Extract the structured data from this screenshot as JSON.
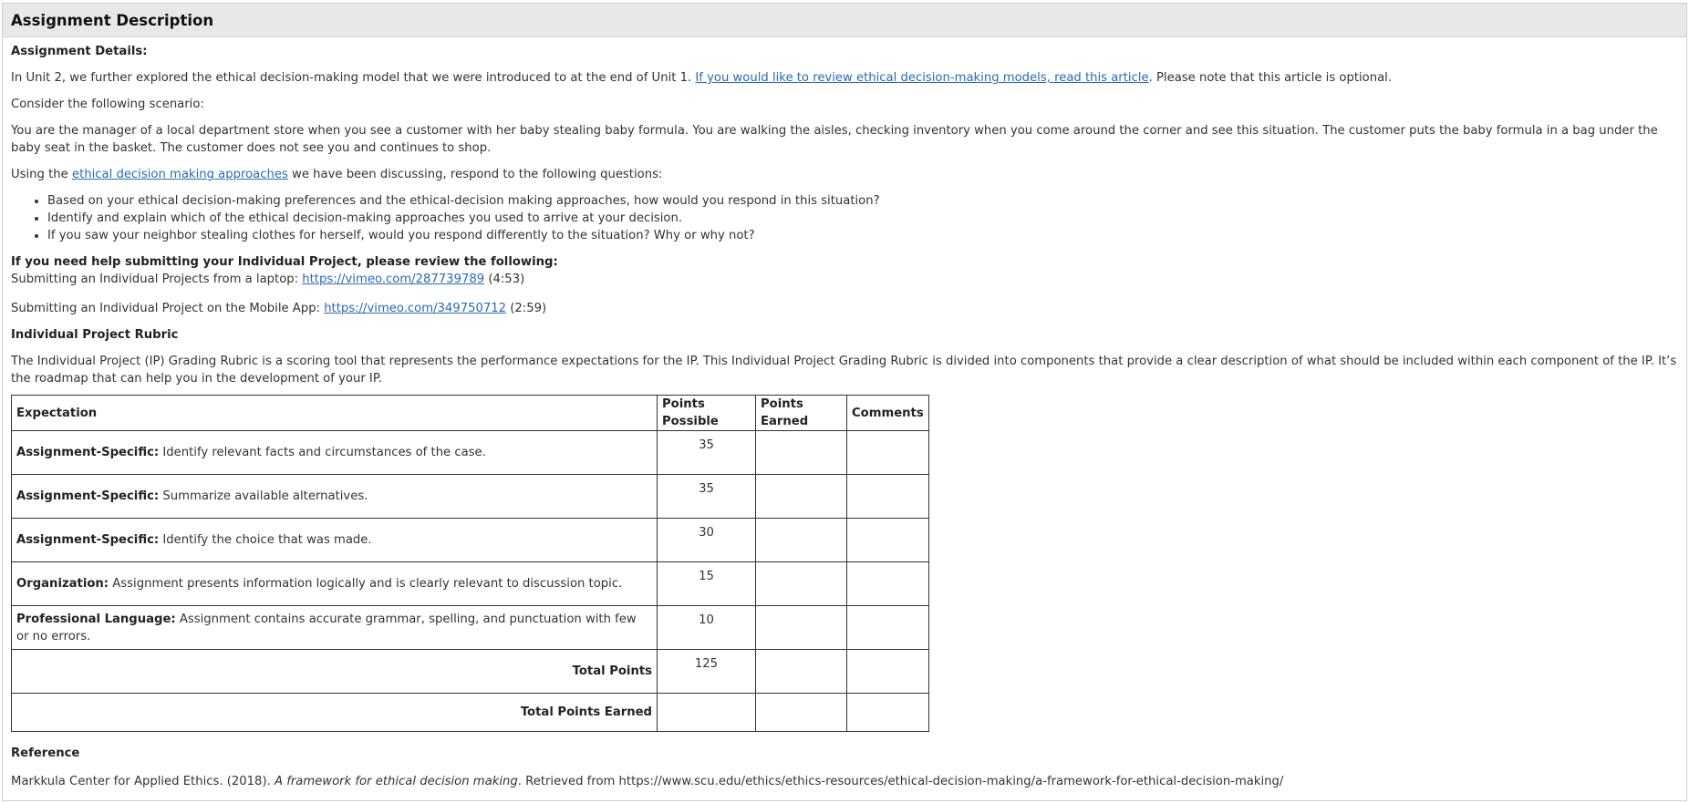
{
  "panel": {
    "title": "Assignment Description"
  },
  "details": {
    "heading": "Assignment Details:",
    "intro_before_link": "In Unit 2, we further explored the ethical decision-making model that we were introduced to at the end of Unit 1. ",
    "intro_link": "If you would like to review ethical decision-making models, read this article",
    "intro_after_link": ". Please note that this article is optional.",
    "consider": "Consider the following scenario:",
    "scenario": "You are the manager of a local department store when you see a customer with her baby stealing baby formula. You are walking the aisles, checking inventory when you come around the corner and see this situation. The customer puts the baby formula in a bag under the baby seat in the basket. The customer does not see you and continues to shop.",
    "using_before_link": "Using the ",
    "using_link": "ethical decision making approaches",
    "using_after_link": " we have been discussing, respond to the following questions:",
    "questions": [
      "Based on your ethical decision-making preferences and the ethical-decision making approaches, how would you respond in this situation?",
      "Identify and explain which of the ethical decision-making approaches you used to arrive at your decision.",
      "If you saw your neighbor stealing clothes for herself, would you respond differently to the situation? Why or why not?"
    ]
  },
  "help": {
    "heading": "If you need help submitting your Individual Project, please review the following:",
    "laptop_text": "Submitting an Individual Projects from a laptop: ",
    "laptop_link": "https://vimeo.com/287739789",
    "laptop_duration": " (4:53)",
    "mobile_text": "Submitting an Individual Project on the Mobile App: ",
    "mobile_link": "https://vimeo.com/349750712",
    "mobile_duration": " (2:59)"
  },
  "rubric": {
    "heading": "Individual Project Rubric",
    "description": "The Individual Project (IP) Grading Rubric is a scoring tool that represents the performance expectations for the IP. This Individual Project Grading Rubric is divided into components that provide a clear description of what should be included within each component of the IP. It’s the roadmap that can help you in the development of your IP.",
    "headers": [
      "Expectation",
      "Points Possible",
      "Points Earned",
      "Comments"
    ],
    "rows": [
      {
        "label": "Assignment-Specific:",
        "text": " Identify relevant facts and circumstances of the case.",
        "points": "35",
        "earned": "",
        "comments": ""
      },
      {
        "label": "Assignment-Specific:",
        "text": " Summarize available alternatives.",
        "points": "35",
        "earned": "",
        "comments": ""
      },
      {
        "label": "Assignment-Specific:",
        "text": " Identify the choice that was made.",
        "points": "30",
        "earned": "",
        "comments": ""
      },
      {
        "label": "Organization:",
        "text": " Assignment presents information logically and is clearly relevant to discussion topic.",
        "points": "15",
        "earned": "",
        "comments": ""
      },
      {
        "label": "Professional Language:",
        "text": " Assignment contains accurate grammar, spelling, and punctuation with few or no errors.",
        "points": "10",
        "earned": "",
        "comments": ""
      }
    ],
    "total_label": "Total Points",
    "total_value": "125",
    "earned_label": "Total Points Earned",
    "earned_value": ""
  },
  "reference": {
    "heading": "Reference",
    "before_italic": "Markkula Center for Applied Ethics. (2018). ",
    "italic": "A framework for ethical decision making",
    "after_italic": ". Retrieved from https://www.scu.edu/ethics/ethics-resources/ethical-decision-making/a-framework-for-ethical-decision-making/"
  }
}
